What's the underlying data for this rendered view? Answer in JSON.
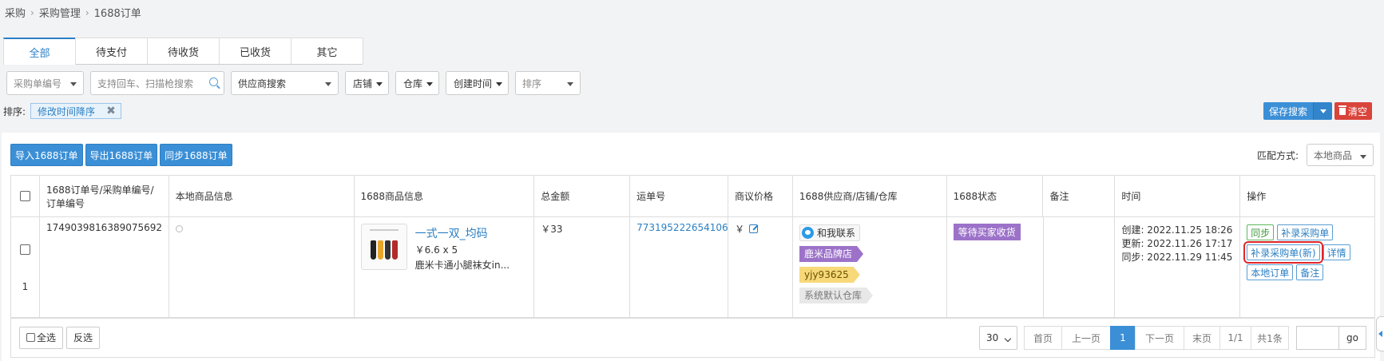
{
  "breadcrumb": [
    "采购",
    "采购管理",
    "1688订单"
  ],
  "tabs": [
    "全部",
    "待支付",
    "待收货",
    "已收货",
    "其它"
  ],
  "filters": {
    "po_field": "采购单编号",
    "search_placeholder": "支持回车、扫描枪搜索",
    "supplier": "供应商搜索",
    "shop": "店铺",
    "warehouse": "仓库",
    "created_time": "创建时间",
    "sort": "排序"
  },
  "sort_row": {
    "label": "排序:",
    "tag": "修改时间降序",
    "remove": "✖"
  },
  "actions": {
    "save_search": "保存搜索",
    "clear": "清空"
  },
  "top_buttons": [
    "导入1688订单",
    "导出1688订单",
    "同步1688订单"
  ],
  "match": {
    "label": "匹配方式:",
    "value": "本地商品"
  },
  "columns": [
    "1688订单号/采购单编号/订单编号",
    "本地商品信息",
    "1688商品信息",
    "总金额",
    "运单号",
    "商议价格",
    "1688供应商/店铺/仓库",
    "1688状态",
    "备注",
    "时间",
    "操作"
  ],
  "row": {
    "index": "1",
    "order_no": "1749039816389075692",
    "product_title": "一式一双_均码",
    "product_price": "￥6.6 x 5",
    "product_desc": "鹿米卡通小腿袜女in...",
    "total": "￥33",
    "waybill": "773195222654106",
    "negotiated": "￥",
    "ww_label": "和我联系",
    "shop_tag": "鹿米品牌店",
    "seller_tag": "yjy93625",
    "warehouse_tag": "系统默认仓库",
    "status": "等待买家收货",
    "remark": "",
    "created": "创建: 2022.11.25 18:26",
    "updated": "更新: 2022.11.26 17:17",
    "synced": "同步: 2022.11.29 11:45",
    "ops": {
      "sync": "同步",
      "add_po": "补录采购单",
      "add_po_new": "补录采购单(新)",
      "detail": "详情",
      "local_order": "本地订单",
      "remark": "备注"
    }
  },
  "footer": {
    "select_all": "全选",
    "invert": "反选",
    "page_size": "30",
    "first": "首页",
    "prev": "上一页",
    "current": "1",
    "next": "下一页",
    "last": "末页",
    "page_info": "1/1",
    "total": "共1条",
    "go": "go"
  },
  "colors": {
    "primary": "#3b8fd6",
    "danger": "#d9443b",
    "status_purple": "#9c72c9",
    "highlight": "#e0262a"
  }
}
